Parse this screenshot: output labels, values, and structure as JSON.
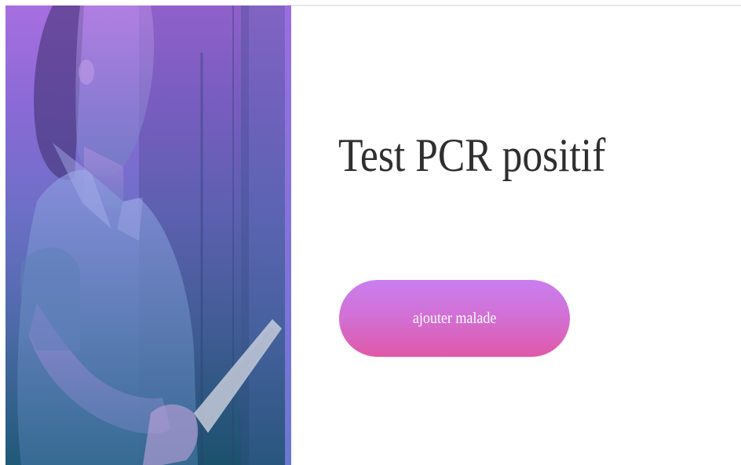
{
  "hero": {
    "image": "woman-holding-tablet-photo",
    "overlay_gradient": [
      "#a76ee0",
      "#1f5a77"
    ]
  },
  "main": {
    "title": "Test PCR positif",
    "add_button_label": "ajouter malade"
  },
  "colors": {
    "button_gradient_top": "#c97ef0",
    "button_gradient_bottom": "#e058a8",
    "title_color": "#2f2f2f"
  }
}
